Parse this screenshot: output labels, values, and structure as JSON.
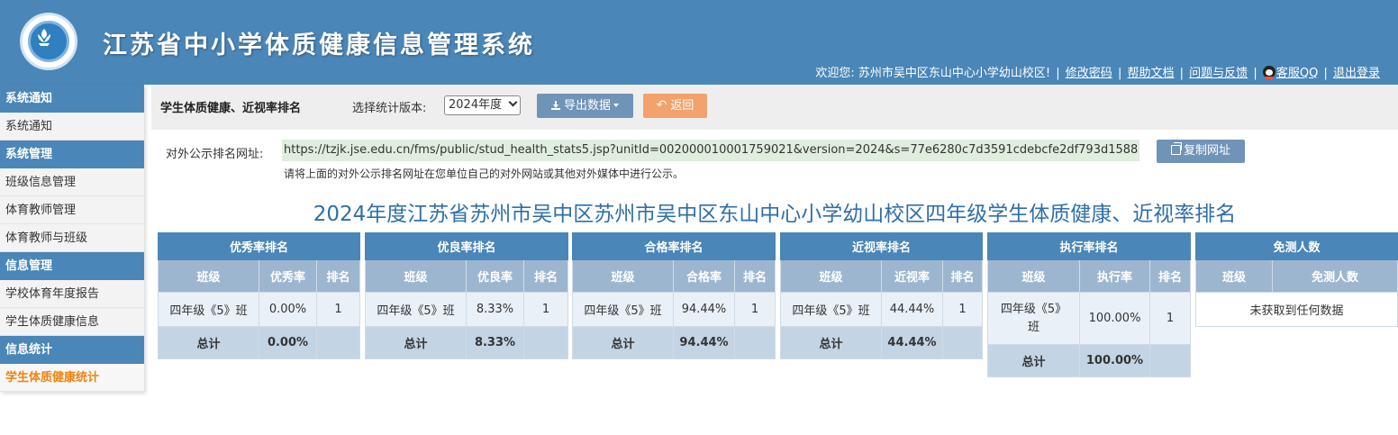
{
  "header": {
    "site_title": "江苏省中小学体质健康信息管理系统",
    "welcome": "欢迎您: 苏州市吴中区东山中心小学幼山校区!",
    "links": {
      "change_password": "修改密码",
      "help_doc": "帮助文档",
      "feedback": "问题与反馈",
      "qq_service": "客服QQ",
      "logout": "退出登录"
    }
  },
  "sidebar": {
    "sections": [
      {
        "title": "系统通知",
        "items": [
          "系统通知"
        ]
      },
      {
        "title": "系统管理",
        "items": [
          "班级信息管理",
          "体育教师管理",
          "体育教师与班级"
        ]
      },
      {
        "title": "信息管理",
        "items": [
          "学校体育年度报告",
          "学生体质健康信息"
        ]
      },
      {
        "title": "信息统计",
        "items": [
          "学生体质健康统计"
        ]
      }
    ]
  },
  "toolbar": {
    "title": "学生体质健康、近视率排名",
    "version_label": "选择统计版本:",
    "version_value": "2024年度",
    "export_label": "导出数据",
    "back_label": "返回"
  },
  "public_url": {
    "label": "对外公示排名网址:",
    "url": "https://tzjk.jse.edu.cn/fms/public/stud_health_stats5.jsp?unitId=002000010001759021&version=2024&s=77e6280c7d3591cdebcfe2df793d1588",
    "copy_label": "复制网址",
    "note": "请将上面的对外公示排名网址在您单位自己的对外网站或其他对外媒体中进行公示。"
  },
  "main_heading": "2024年度江苏省苏州市吴中区苏州市吴中区东山中心小学幼山校区四年级学生体质健康、近视率排名",
  "tables": {
    "excellent": {
      "caption": "优秀率排名",
      "col_class": "班级",
      "col_rate": "优秀率",
      "col_rank": "排名",
      "class": "四年级《5》班",
      "rate": "0.00%",
      "rank": "1",
      "total_label": "总计",
      "total": "0.00%"
    },
    "good": {
      "caption": "优良率排名",
      "col_class": "班级",
      "col_rate": "优良率",
      "col_rank": "排名",
      "class": "四年级《5》班",
      "rate": "8.33%",
      "rank": "1",
      "total_label": "总计",
      "total": "8.33%"
    },
    "pass": {
      "caption": "合格率排名",
      "col_class": "班级",
      "col_rate": "合格率",
      "col_rank": "排名",
      "class": "四年级《5》班",
      "rate": "94.44%",
      "rank": "1",
      "total_label": "总计",
      "total": "94.44%"
    },
    "myopia": {
      "caption": "近视率排名",
      "col_class": "班级",
      "col_rate": "近视率",
      "col_rank": "排名",
      "class": "四年级《5》班",
      "rate": "44.44%",
      "rank": "1",
      "total_label": "总计",
      "total": "44.44%"
    },
    "execution": {
      "caption": "执行率排名",
      "col_class": "班级",
      "col_rate": "执行率",
      "col_rank": "排名",
      "class": "四年级《5》班",
      "rate": "100.00%",
      "rank": "1",
      "total_label": "总计",
      "total": "100.00%"
    },
    "exempt": {
      "caption": "免测人数",
      "col_class": "班级",
      "col_count": "免测人数",
      "empty_text": "未获取到任何数据"
    }
  },
  "colors": {
    "header_bg": "#4a86b7",
    "heading_text": "#2f6fa8",
    "active_sidebar": "#f0820f",
    "export_button": "#7093b8",
    "back_button": "#f4a26b"
  }
}
